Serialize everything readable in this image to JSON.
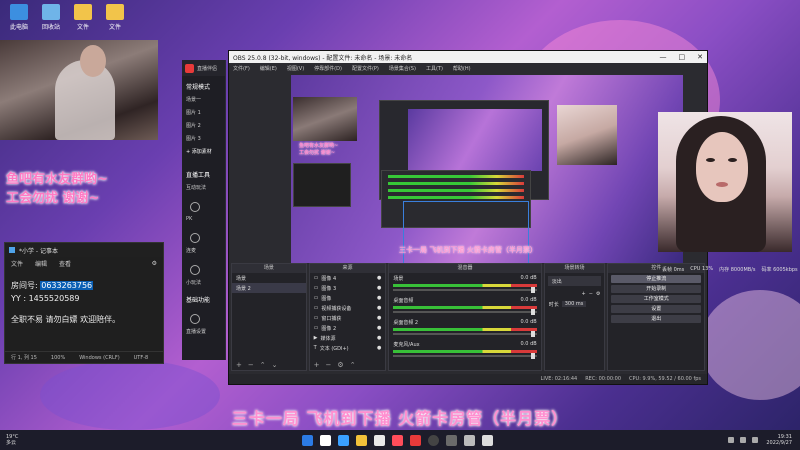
{
  "desktop": {
    "icons": [
      {
        "label": "此电脑",
        "color": "#3c8fe0"
      },
      {
        "label": "回收站",
        "color": "#6fb4e8"
      },
      {
        "label": "文件",
        "color": "#f2c44a"
      },
      {
        "label": "文件",
        "color": "#f2c44a"
      }
    ],
    "overlay_line1": "鱼吧有水友群哟~",
    "overlay_line2": "工会勿扰 谢谢~",
    "subtitle": "三卡一局 飞机到下播 火箭卡房管（半月票）"
  },
  "notepad": {
    "title": "*小学 - 记事本",
    "menu": [
      "文件",
      "编辑",
      "查看"
    ],
    "line1_label": "房间号:",
    "line1_value": "0633263756",
    "line2_label": "YY :",
    "line2_value": "1455520589",
    "line3": "全职不易 请勿白嫖 欢迎陪伴。",
    "status": [
      "行 1, 列 15",
      "100%",
      "Windows (CRLF)",
      "UTF-8"
    ]
  },
  "live_app": {
    "title": "直播伴侣",
    "mode": "常规模式",
    "scene_items": [
      "场景一",
      "图片 1",
      "图片 2",
      "图片 3"
    ],
    "add_button": "+ 添加素材",
    "tools_heading": "直播工具",
    "interact": "互动玩法",
    "tool_labels": [
      "PK",
      "连麦",
      "心愿",
      "小玩法"
    ],
    "basic_heading": "基础功能",
    "basic_label": "直播设置"
  },
  "obs": {
    "title": "OBS 25.0.8 (32-bit, windows) - 配置文件: 未命名 - 场景: 未命名",
    "menu": [
      "文件(F)",
      "编辑(E)",
      "视图(V)",
      "停靠部件(D)",
      "配置文件(P)",
      "场景集合(S)",
      "工具(T)",
      "帮助(H)"
    ],
    "preview": {
      "mini_text1": "鱼吧有水友群哟~",
      "mini_text2": "工会勿扰 谢谢~",
      "bottom_text": "三卡一局 飞机到下播 火箭卡房管（半月票）"
    },
    "docks": {
      "scenes": {
        "header": "场景",
        "items": [
          "场景",
          "场景 2"
        ]
      },
      "sources": {
        "header": "来源",
        "items": [
          "图像 4",
          "图像 3",
          "图像",
          "视频捕获设备",
          "窗口捕获",
          "图像 2",
          "媒体源",
          "文本 (GDI+)",
          "图像 5",
          "浏览器"
        ]
      },
      "mixer": {
        "header": "混音器",
        "channels": [
          {
            "name": "场景",
            "db": "0.0 dB",
            "level": 0.62
          },
          {
            "name": "桌面音频",
            "db": "0.0 dB",
            "level": 0.55
          },
          {
            "name": "桌面音频 2",
            "db": "0.0 dB",
            "level": 0.48
          },
          {
            "name": "麦克风/Aux",
            "db": "0.0 dB",
            "level": 0.7
          }
        ]
      },
      "transitions": {
        "header": "场景转场",
        "type": "淡出",
        "duration_label": "时长",
        "duration": "300 ms"
      },
      "controls": {
        "header": "控件",
        "buttons": [
          "停止推流",
          "开始录制",
          "工作室模式",
          "设置",
          "退出"
        ]
      }
    },
    "status": [
      "LIVE: 02:16:44",
      "REC: 00:00:00",
      "CPU: 9.9%, 59.52 / 60.00 fps"
    ]
  },
  "stats": [
    "丢帧 0ms",
    "CPU 13%",
    "内存 8000MB/s",
    "码率 6005kbps"
  ],
  "taskbar": {
    "weather_temp": "19°C",
    "weather_desc": "多云",
    "time": "19:31",
    "date": "2022/9/27",
    "app_colors": [
      "#2c7be5",
      "#ffffff",
      "#3aa0ff",
      "#f3c23a",
      "#e8e8e8",
      "#ff4d5a",
      "#e83a3a",
      "#444444",
      "#6a6a6a",
      "#bbbbbb",
      "#dddddd"
    ]
  }
}
